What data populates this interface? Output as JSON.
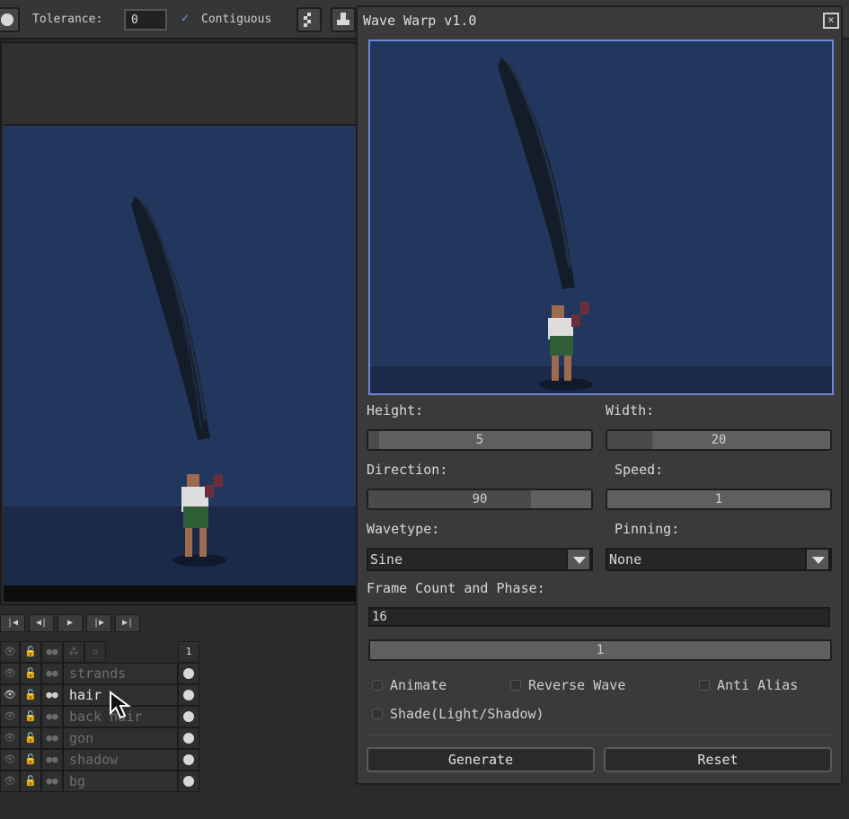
{
  "toolbar": {
    "tolerance_label": "Tolerance:",
    "tolerance_value": "0",
    "contiguous_label": "Contiguous",
    "contiguous_checked": true
  },
  "playback": {
    "buttons": [
      "first-frame",
      "previous-frame",
      "play",
      "next-frame",
      "last-frame"
    ]
  },
  "layers": {
    "header_frame": "1",
    "items": [
      {
        "name": "strands",
        "active": false
      },
      {
        "name": "hair",
        "active": true
      },
      {
        "name": "back hair",
        "active": false
      },
      {
        "name": "gon",
        "active": false
      },
      {
        "name": "shadow",
        "active": false
      },
      {
        "name": "bg",
        "active": false
      }
    ]
  },
  "dialog": {
    "title": "Wave Warp v1.0",
    "close_label": "×",
    "height_label": "Height:",
    "height_value": "5",
    "height_fraction": 0.05,
    "width_label": "Width:",
    "width_value": "20",
    "width_fraction": 0.2,
    "direction_label": "Direction:",
    "direction_value": "90",
    "direction_fraction": 0.73,
    "speed_label": "Speed:",
    "speed_value": "1",
    "speed_fraction": 0.0,
    "wavetype_label": "Wavetype:",
    "wavetype_value": "Sine",
    "pinning_label": "Pinning:",
    "pinning_value": "None",
    "frame_label": "Frame Count and Phase:",
    "frame_count_value": "16",
    "phase_value": "1",
    "animate_label": "Animate",
    "reverse_label": "Reverse Wave",
    "antialias_label": "Anti Alias",
    "shade_label": "Shade(Light/Shadow)",
    "generate_label": "Generate",
    "reset_label": "Reset"
  },
  "colors": {
    "sky": "#22375d",
    "ground": "#1b2a48",
    "hair": "#141c2a",
    "preview_border": "#6f86d6"
  }
}
